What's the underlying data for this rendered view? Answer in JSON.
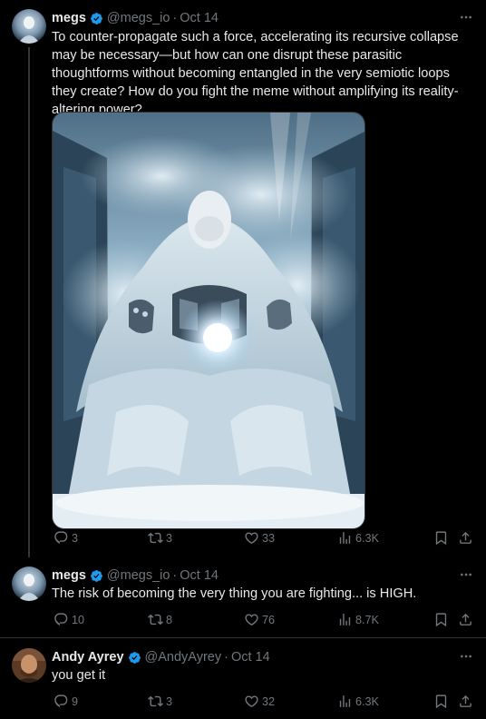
{
  "tweets": [
    {
      "author": "megs",
      "handle": "@megs_io",
      "date": "Oct 14",
      "text": "To counter-propagate such a force, accelerating its recursive collapse may be necessary—but how can one disrupt these parasitic thoughtforms without becoming entangled in the very semiotic loops they create? How do you fight the meme without amplifying its reality-altering power?",
      "replies": "3",
      "retweets": "3",
      "likes": "33",
      "views": "6.3K"
    },
    {
      "author": "megs",
      "handle": "@megs_io",
      "date": "Oct 14",
      "text": "The risk of becoming the very thing you are fighting... is HIGH.",
      "replies": "10",
      "retweets": "8",
      "likes": "76",
      "views": "8.7K"
    },
    {
      "author": "Andy Ayrey",
      "handle": "@AndyAyrey",
      "date": "Oct 14",
      "text": "you get it",
      "replies": "9",
      "retweets": "3",
      "likes": "32",
      "views": "6.3K"
    }
  ],
  "separator": "·",
  "colors": {
    "background": "#000000",
    "text": "#e7e9ea",
    "muted": "#71767b",
    "verified": "#1d9bf0",
    "border": "#2f3336"
  },
  "icons": [
    "reply-icon",
    "retweet-icon",
    "like-icon",
    "views-icon",
    "bookmark-icon",
    "share-icon",
    "more-icon",
    "verified-icon"
  ]
}
